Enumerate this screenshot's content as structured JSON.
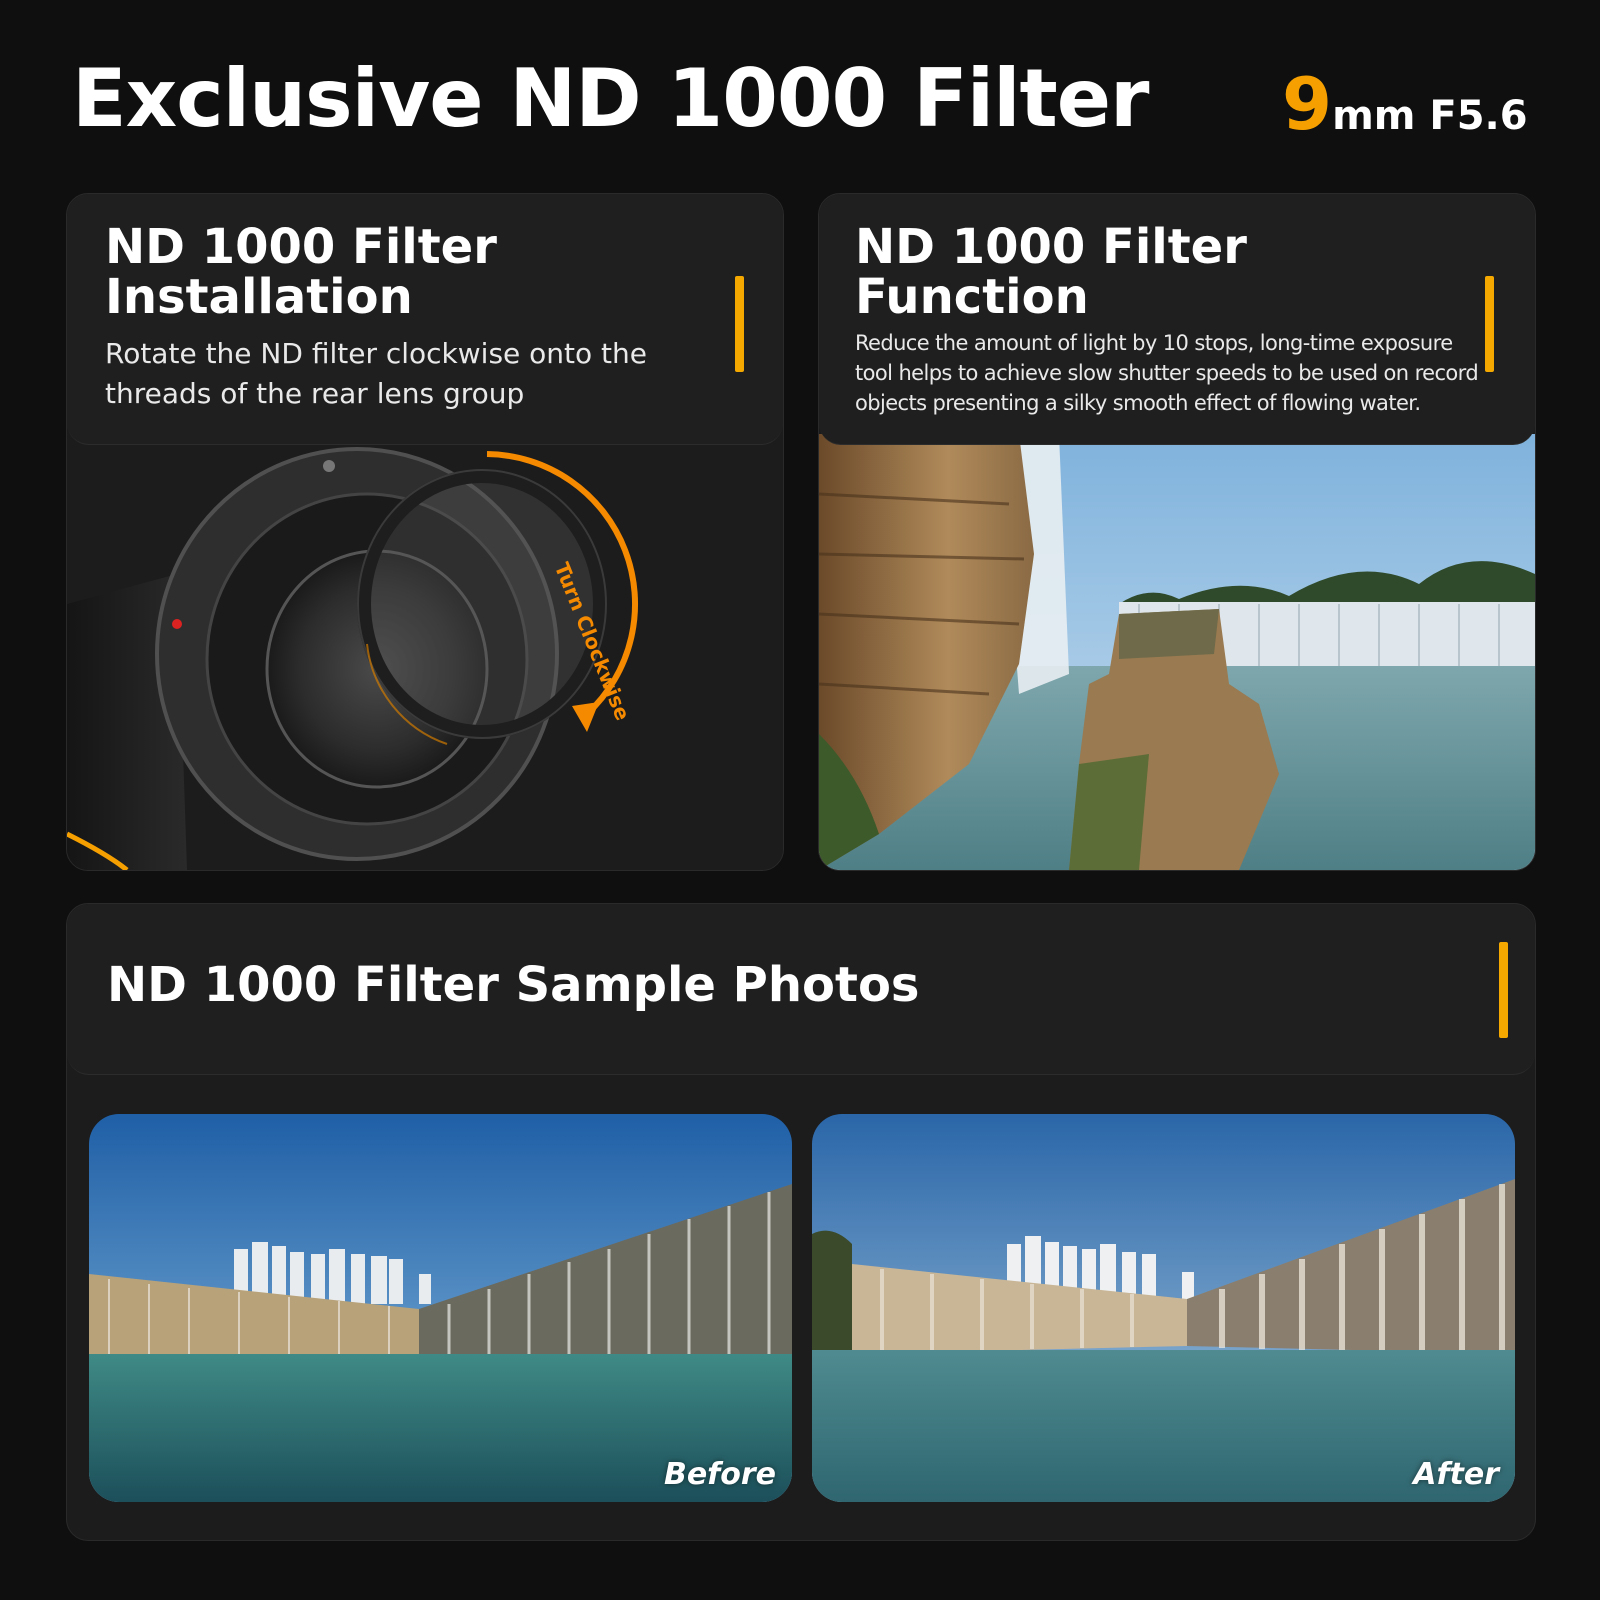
{
  "header": {
    "title": "Exclusive ND 1000 Filter",
    "lens_focal": "9",
    "lens_rest": "mm F5.6"
  },
  "installation": {
    "title_line1": "ND 1000 Filter",
    "title_line2": "Installation",
    "description_line1": "Rotate the ND filter clockwise onto the",
    "description_line2": "threads of the rear lens group",
    "arrow_label": "Turn Clockwise"
  },
  "function": {
    "title_line1": "ND 1000 Filter",
    "title_line2": "Function",
    "description_line1": "Reduce the amount of light by 10 stops, long-time exposure",
    "description_line2": "tool helps to achieve slow shutter speeds to be used on record",
    "description_line3": "objects presenting a silky smooth effect of flowing water."
  },
  "samples": {
    "title": "ND 1000 Filter Sample Photos",
    "before_label": "Before",
    "after_label": "After"
  },
  "colors": {
    "accent": "#f5a800",
    "background": "#0f0f0f",
    "card": "#1c1c1c"
  }
}
